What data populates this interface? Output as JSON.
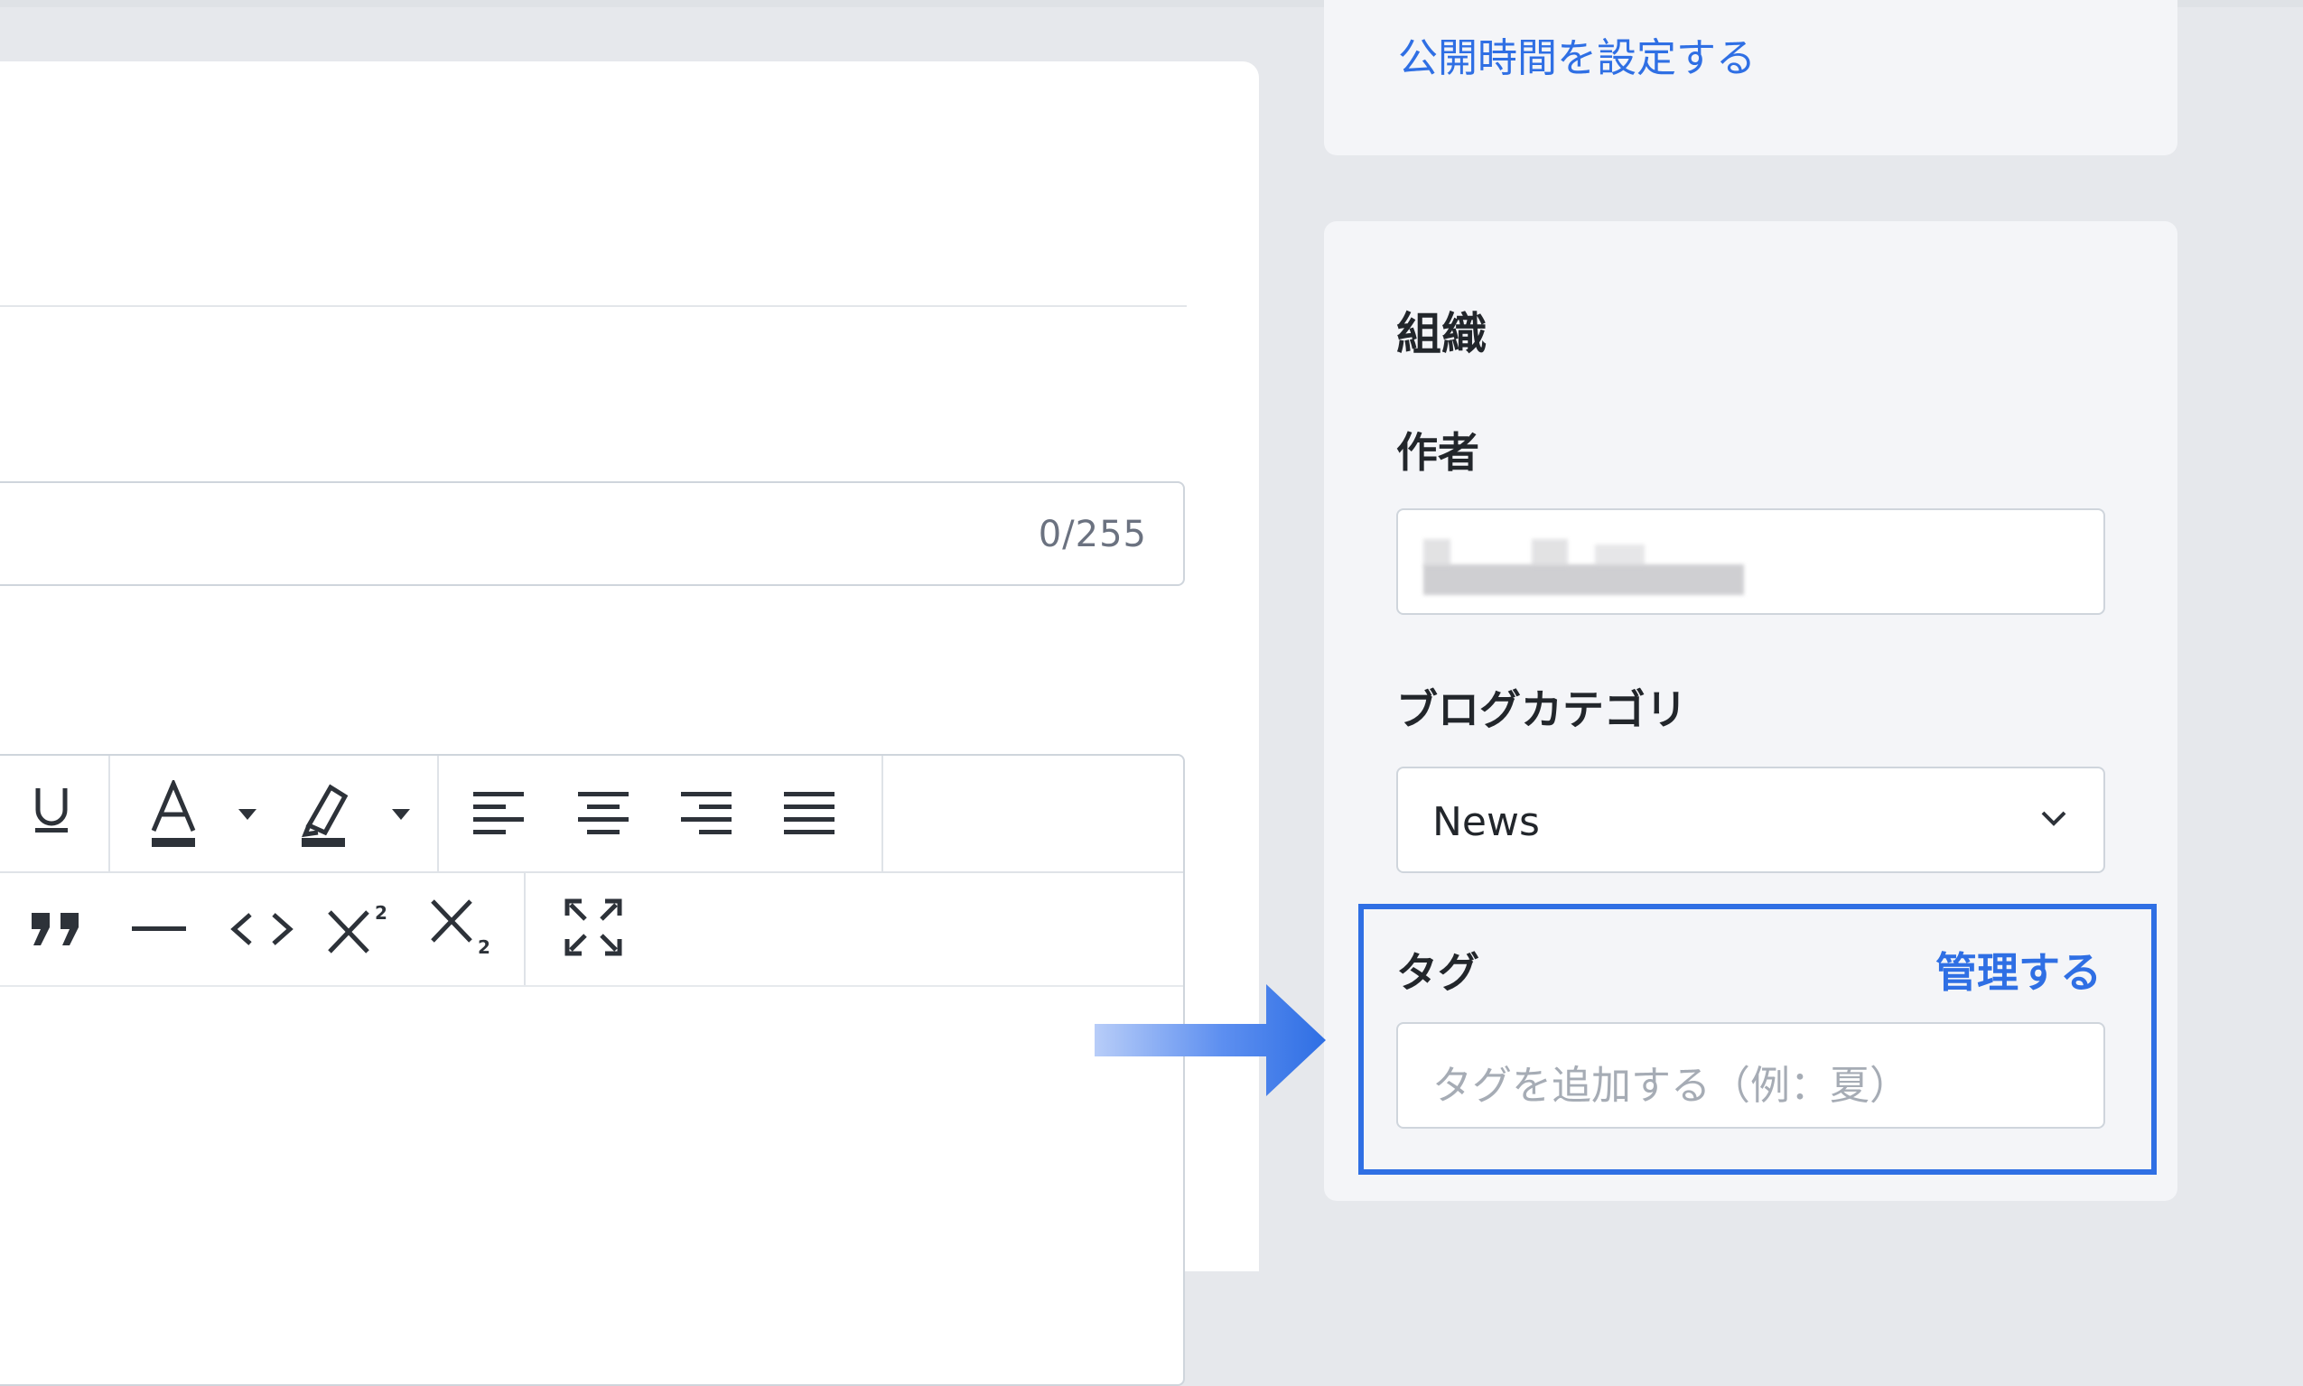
{
  "publish": {
    "set_time_link": "公開時間を設定する"
  },
  "editor": {
    "char_count": "0/255"
  },
  "organization": {
    "title": "組織",
    "author_label": "作者",
    "author_value_hidden": true,
    "category_label": "ブログカテゴリ",
    "category_value": "News",
    "tags_label": "タグ",
    "tags_manage_link": "管理する",
    "tags_placeholder": "タグを追加する（例：夏）"
  },
  "toolbar_icons": [
    "underline-icon",
    "text-color-icon",
    "highlight-icon",
    "align-left-icon",
    "align-center-icon",
    "align-right-icon",
    "align-justify-icon",
    "blockquote-icon",
    "horizontal-rule-icon",
    "code-icon",
    "superscript-icon",
    "subscript-icon",
    "fullscreen-icon"
  ],
  "colors": {
    "accent": "#2f6fe4",
    "highlight_border": "#2f6fe4"
  }
}
